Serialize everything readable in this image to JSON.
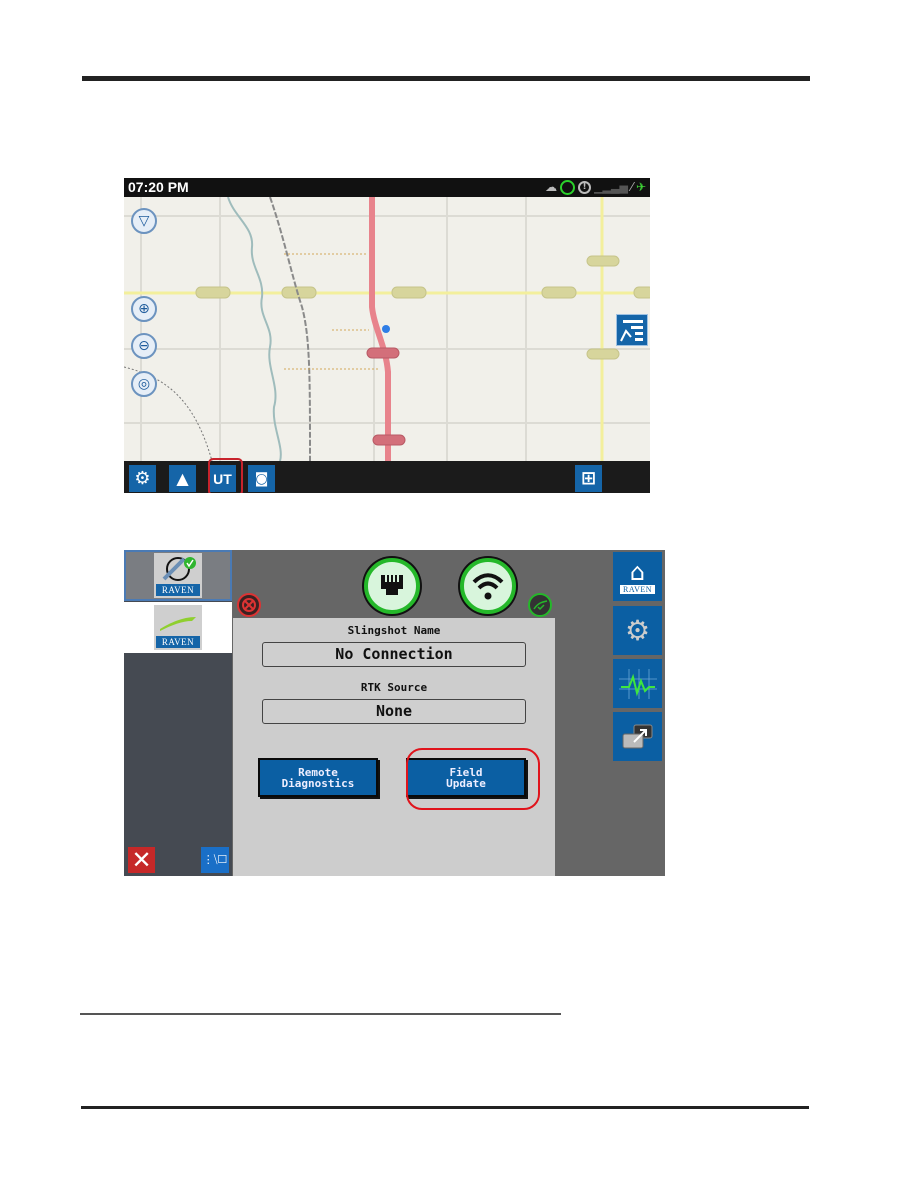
{
  "document": {
    "rules": [
      "header-rule",
      "footnote-rule",
      "footer-rule"
    ]
  },
  "map_screen": {
    "status_bar": {
      "time": "07:20 PM",
      "icons": [
        "weather-icon",
        "steering-wheel-icon",
        "alarm-icon",
        "signal-bars-icon",
        "link-icon",
        "gps-satellite-icon"
      ]
    },
    "map_controls": [
      "filter-icon",
      "zoom-in-icon",
      "zoom-out-icon",
      "recenter-icon"
    ],
    "toolbar": {
      "buttons": [
        {
          "name": "settings",
          "glyph": "⚙"
        },
        {
          "name": "alerts",
          "glyph": "🔔"
        },
        {
          "name": "universal-terminal",
          "glyph": "UT",
          "highlighted": true
        },
        {
          "name": "camera",
          "glyph": "📷"
        }
      ],
      "right_button": {
        "name": "add-layer",
        "glyph": "+"
      }
    },
    "colors": {
      "accent": "#1565a8",
      "highway": "#e8838c",
      "road": "#f3ef9c",
      "highlight": "#c8232c"
    }
  },
  "slingshot_screen": {
    "apps": [
      {
        "name": "slingshot-app",
        "brand": "RAVEN",
        "selected": true
      },
      {
        "name": "guidance-app",
        "brand": "RAVEN",
        "selected": false
      }
    ],
    "connection_icons": [
      "ethernet-icon",
      "wifi-icon"
    ],
    "slingshot_name_label": "Slingshot Name",
    "slingshot_name_value": "No Connection",
    "rtk_source_label": "RTK Source",
    "rtk_source_value": "None",
    "buttons": {
      "remote_diagnostics": [
        "Remote",
        "Diagnostics"
      ],
      "field_update": [
        "Field",
        "Update"
      ]
    },
    "side_buttons": [
      {
        "name": "home",
        "brand": "RAVEN"
      },
      {
        "name": "settings"
      },
      {
        "name": "diagnostics"
      },
      {
        "name": "switch-window"
      }
    ],
    "colors": {
      "panel": "#cdcdcd",
      "button": "#0b5fa3",
      "ok": "#25b82a",
      "error": "#c62828",
      "highlight": "#e0141c"
    }
  }
}
